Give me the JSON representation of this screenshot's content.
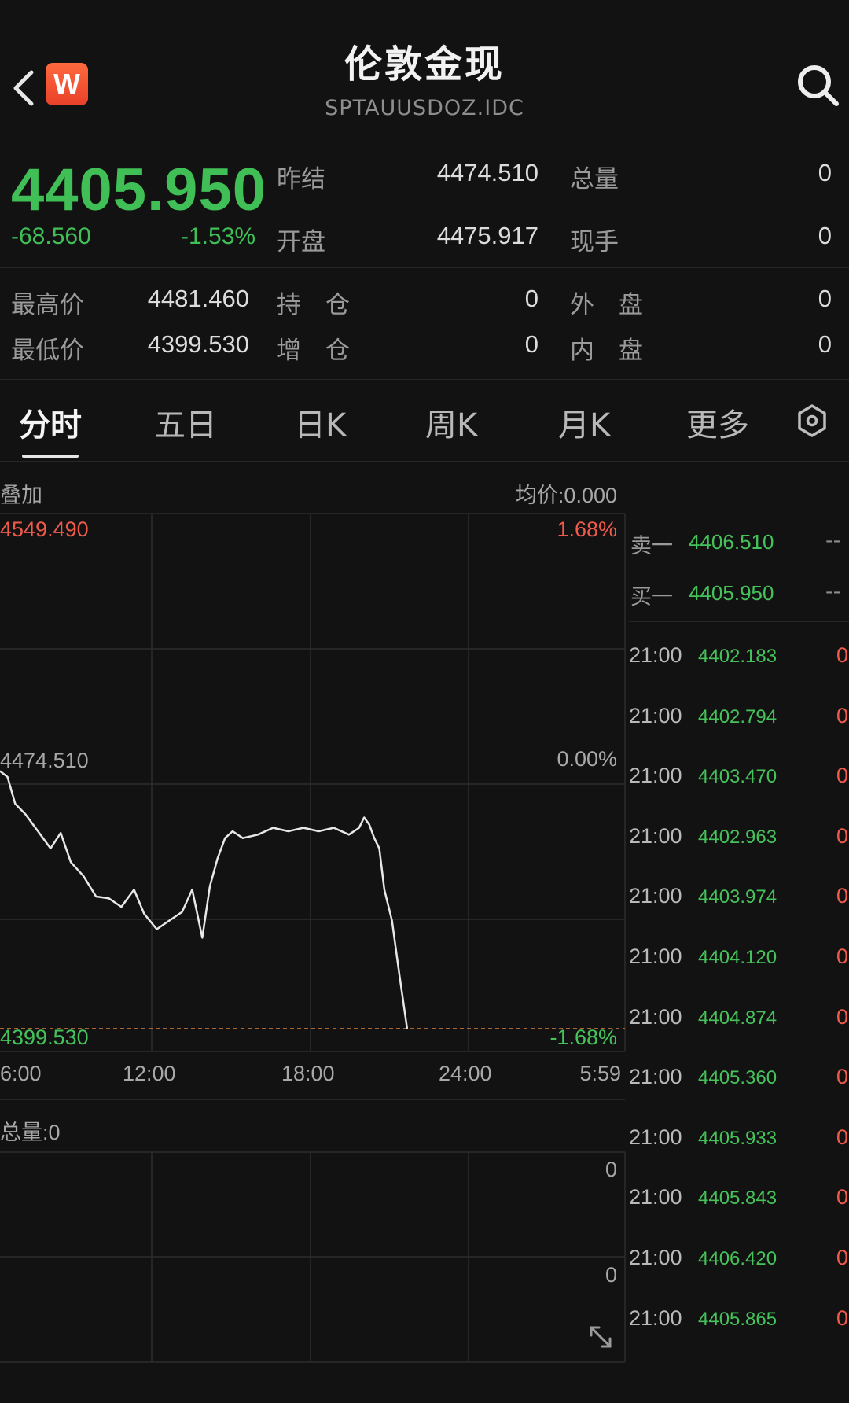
{
  "header": {
    "title": "伦敦金现",
    "subtitle": "SPTAUUSDOZ.IDC",
    "logo_text": "W"
  },
  "quote": {
    "price": "4405.950",
    "change": "-68.560",
    "change_pct": "-1.53%",
    "stats": [
      {
        "label": "昨结",
        "value": "4474.510"
      },
      {
        "label": "总量",
        "value": "0"
      },
      {
        "label": "开盘",
        "value": "4475.917"
      },
      {
        "label": "现手",
        "value": "0"
      },
      {
        "label": "最高价",
        "value": "4481.460"
      },
      {
        "label": "持　仓",
        "value": "0"
      },
      {
        "label": "外　盘",
        "value": "0"
      },
      {
        "label": "最低价",
        "value": "4399.530"
      },
      {
        "label": "增　仓",
        "value": "0"
      },
      {
        "label": "内　盘",
        "value": "0"
      }
    ]
  },
  "tabs": [
    "分时",
    "五日",
    "日K",
    "周K",
    "月K",
    "更多"
  ],
  "active_tab": "分时",
  "chart": {
    "overlay_label": "叠加",
    "avg_label": "均价:0.000",
    "y_high": "4549.490",
    "y_mid": "4474.510",
    "y_low": "4399.530",
    "pct_high": "1.68%",
    "pct_mid": "0.00%",
    "pct_low": "-1.68%",
    "x_labels": [
      "6:00",
      "12:00",
      "18:00",
      "24:00",
      "5:59"
    ],
    "volume_label": "总量:0",
    "vol_tick_top": "0",
    "vol_tick_bottom": "0"
  },
  "chart_data": {
    "type": "line",
    "x_labels": [
      "6:00",
      "12:00",
      "18:00",
      "24:00",
      "5:59"
    ],
    "ylim": [
      4399.53,
      4549.49
    ],
    "reference": 4474.51,
    "series": [
      {
        "x": [
          0,
          0.3,
          0.6,
          1.0,
          1.5,
          2.0,
          2.4,
          2.8,
          3.3,
          3.8,
          4.3,
          4.8,
          5.3,
          5.7,
          6.2,
          6.7,
          7.2,
          7.6,
          8.0,
          8.3,
          8.6,
          8.9,
          9.2,
          9.6,
          10.2,
          10.8,
          11.4,
          12.0,
          12.6,
          13.2,
          13.8,
          14.2,
          14.4,
          14.6,
          14.8,
          15.0,
          15.2,
          15.5,
          15.8,
          16.1
        ],
        "values": [
          4474.5,
          4472.8,
          4465.0,
          4462.0,
          4457.0,
          4452.0,
          4456.5,
          4448.0,
          4444.0,
          4438.0,
          4437.5,
          4435.0,
          4440.0,
          4433.0,
          4428.5,
          4431.0,
          4433.5,
          4440.0,
          4426.0,
          4441.0,
          4449.0,
          4455.0,
          4457.0,
          4455.0,
          4456.0,
          4458.0,
          4457.0,
          4458.0,
          4457.0,
          4458.0,
          4456.0,
          4458.0,
          4461.0,
          4459.0,
          4455.0,
          4452.0,
          4440.0,
          4431.0,
          4415.0,
          4399.53
        ]
      }
    ]
  },
  "order_book": [
    {
      "label": "卖一",
      "price": "4406.510",
      "qty": "--"
    },
    {
      "label": "买一",
      "price": "4405.950",
      "qty": "--"
    }
  ],
  "ticks": [
    {
      "time": "21:00",
      "price": "4402.183",
      "vol": "0"
    },
    {
      "time": "21:00",
      "price": "4402.794",
      "vol": "0"
    },
    {
      "time": "21:00",
      "price": "4403.470",
      "vol": "0"
    },
    {
      "time": "21:00",
      "price": "4402.963",
      "vol": "0"
    },
    {
      "time": "21:00",
      "price": "4403.974",
      "vol": "0"
    },
    {
      "time": "21:00",
      "price": "4404.120",
      "vol": "0"
    },
    {
      "time": "21:00",
      "price": "4404.874",
      "vol": "0"
    },
    {
      "time": "21:00",
      "price": "4405.360",
      "vol": "0"
    },
    {
      "time": "21:00",
      "price": "4405.933",
      "vol": "0"
    },
    {
      "time": "21:00",
      "price": "4405.843",
      "vol": "0"
    },
    {
      "time": "21:00",
      "price": "4406.420",
      "vol": "0"
    },
    {
      "time": "21:00",
      "price": "4405.865",
      "vol": "0"
    }
  ],
  "colors": {
    "up": "#f05a4b",
    "down": "#45c35a",
    "background": "#121212",
    "line": "#e8e8e8",
    "reference_line": "#e0883a"
  },
  "icons": [
    "back-icon",
    "search-icon",
    "settings-icon",
    "expand-icon"
  ]
}
